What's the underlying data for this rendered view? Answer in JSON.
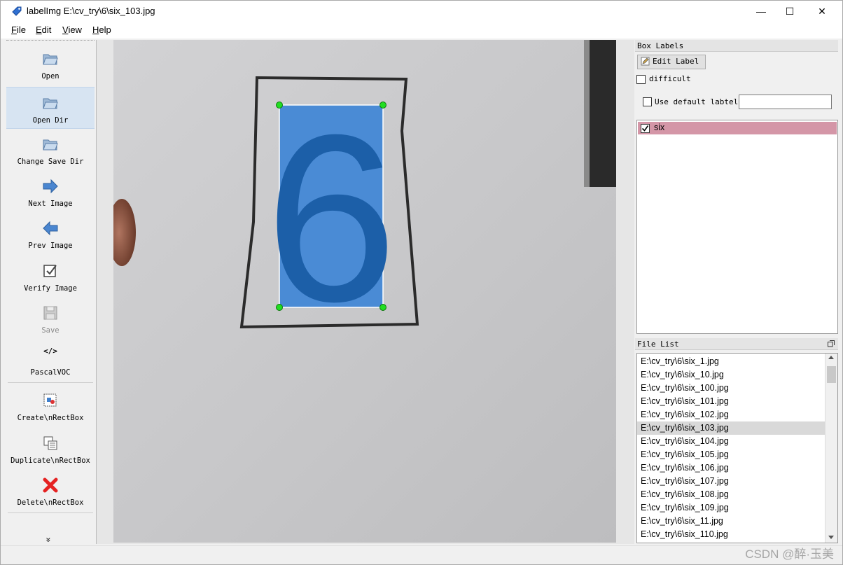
{
  "window": {
    "title": "labelImg E:\\cv_try\\6\\six_103.jpg"
  },
  "window_controls": {
    "minimize": "—",
    "maximize": "☐",
    "close": "✕"
  },
  "menu": [
    {
      "label": "File",
      "mnemonic": "F",
      "rest": "ile"
    },
    {
      "label": "Edit",
      "mnemonic": "E",
      "rest": "dit"
    },
    {
      "label": "View",
      "mnemonic": "V",
      "rest": "iew"
    },
    {
      "label": "Help",
      "mnemonic": "H",
      "rest": "elp"
    }
  ],
  "toolbar": {
    "open": "Open",
    "open_dir": "Open Dir",
    "change_save_dir": "Change Save Dir",
    "next_image": "Next Image",
    "prev_image": "Prev Image",
    "verify_image": "Verify Image",
    "save": "Save",
    "format_icon_text": "</>",
    "format": "PascalVOC",
    "create_rect": "Create\\nRectBox",
    "duplicate_rect": "Duplicate\\nRectBox",
    "delete_rect": "Delete\\nRectBox",
    "more": "»"
  },
  "box_labels": {
    "title": "Box Labels",
    "edit_label": "Edit Label",
    "difficult": "difficult",
    "use_default": "Use default labtel",
    "default_value": "",
    "labels": [
      {
        "text": "six",
        "checked": true
      }
    ]
  },
  "file_list": {
    "title": "File List",
    "selected_index": 5,
    "items": [
      "E:\\cv_try\\6\\six_1.jpg",
      "E:\\cv_try\\6\\six_10.jpg",
      "E:\\cv_try\\6\\six_100.jpg",
      "E:\\cv_try\\6\\six_101.jpg",
      "E:\\cv_try\\6\\six_102.jpg",
      "E:\\cv_try\\6\\six_103.jpg",
      "E:\\cv_try\\6\\six_104.jpg",
      "E:\\cv_try\\6\\six_105.jpg",
      "E:\\cv_try\\6\\six_106.jpg",
      "E:\\cv_try\\6\\six_107.jpg",
      "E:\\cv_try\\6\\six_108.jpg",
      "E:\\cv_try\\6\\six_109.jpg",
      "E:\\cv_try\\6\\six_11.jpg",
      "E:\\cv_try\\6\\six_110.jpg"
    ]
  },
  "canvas": {
    "digit": "6",
    "box_color": "#3f86d6",
    "handle_color": "#22dd22"
  },
  "watermark": "CSDN @醉·玉美",
  "colors": {
    "label_highlight": "#d496a7",
    "selected_file": "#d9d9d9",
    "active_tool": "#d7e4f2"
  }
}
